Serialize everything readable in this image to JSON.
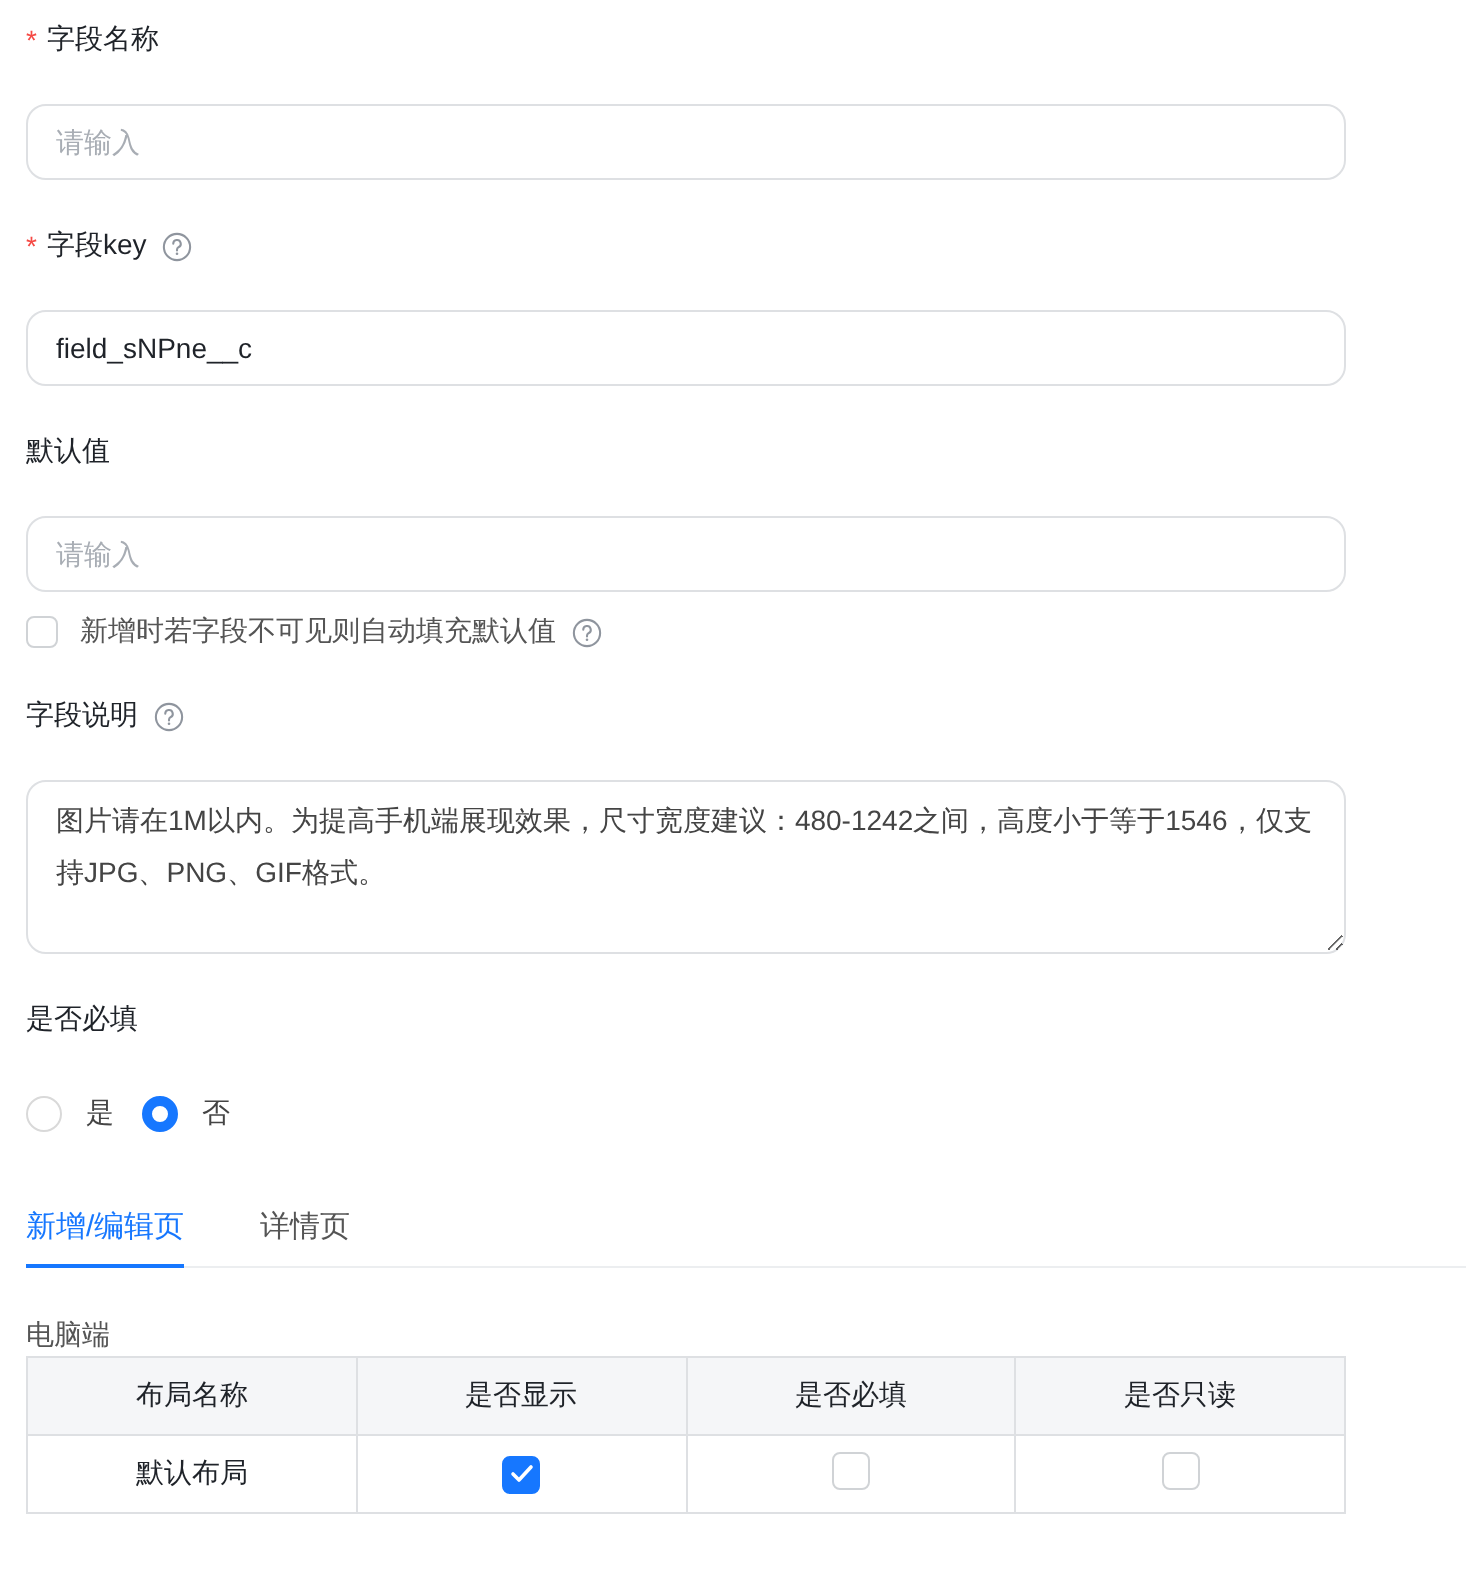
{
  "fields": [
    {
      "kind": "input",
      "label": "字段名称",
      "required_mark": "*",
      "placeholder": "请输入"
    },
    {
      "kind": "input",
      "label": "字段key",
      "required_mark": "*",
      "help": true,
      "value": "field_sNPne__c"
    },
    {
      "kind": "input",
      "label": "默认值",
      "placeholder": "请输入",
      "option": {
        "label": "新增时若字段不可见则自动填充默认值",
        "checked": false,
        "help": true
      }
    },
    {
      "kind": "textarea",
      "label": "字段说明",
      "help": true,
      "value": "图片请在1M以内。为提高手机端展现效果，尺寸宽度建议：480-1242之间，高度小于等于1546，仅支持JPG、PNG、GIF格式。"
    },
    {
      "kind": "radio",
      "label": "是否必填",
      "options": [
        {
          "label": "是",
          "selected": false
        },
        {
          "label": "否",
          "selected": true
        }
      ]
    }
  ],
  "tabs": [
    {
      "label": "新增/编辑页",
      "selected": true
    },
    {
      "label": "详情页",
      "selected": false
    }
  ],
  "section_title": "电脑端",
  "table": {
    "columns": [
      "布局名称",
      "是否显示",
      "是否必填",
      "是否只读"
    ],
    "rows": [
      {
        "name": "默认布局",
        "visible": true,
        "required": false,
        "readonly": false
      }
    ]
  }
}
